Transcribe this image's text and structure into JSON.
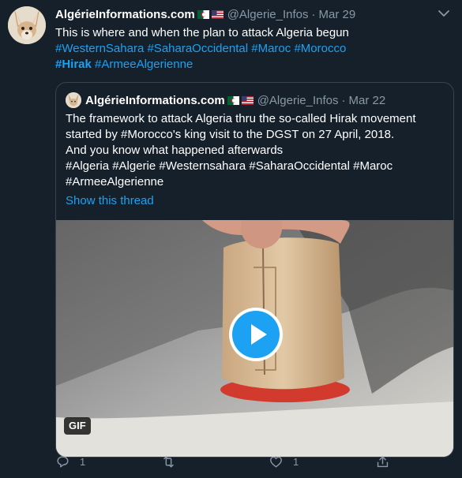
{
  "tweet": {
    "display_name": "AlgérieInformations.com",
    "handle": "@Algerie_Infos",
    "separator": "·",
    "date": "Mar 29",
    "text_line1": "This is where and when the plan to attack Algeria begun",
    "hashtags_line2": [
      "#WesternSahara",
      "#SaharaOccidental",
      "#Maroc",
      "#Morocco"
    ],
    "hashtags_line3": [
      "#Hirak",
      "#ArmeeAlgerienne"
    ]
  },
  "quoted_tweet": {
    "display_name": "AlgérieInformations.com",
    "handle": "@Algerie_Infos",
    "separator": "·",
    "date": "Mar 22",
    "lines": [
      "The framework to attack Algeria thru the so-called Hirak movement",
      "started by #Morocco's king visit to the DGST on 27 April, 2018.",
      "And you know what happened afterwards",
      "#Algeria #Algerie #Westernsahara #SaharaOccidental #Maroc",
      "#ArmeeAlgerienne"
    ],
    "show_thread": "Show this thread",
    "media_badge": "GIF"
  },
  "actions": {
    "reply_count": "1",
    "retweet_count": "",
    "like_count": "1",
    "icons": [
      "reply-icon",
      "retweet-icon",
      "like-icon",
      "share-icon"
    ]
  },
  "colors": {
    "background": "#15202b",
    "text": "#ffffff",
    "muted": "#8899a6",
    "accent": "#1da1f2",
    "border": "#38444d"
  }
}
